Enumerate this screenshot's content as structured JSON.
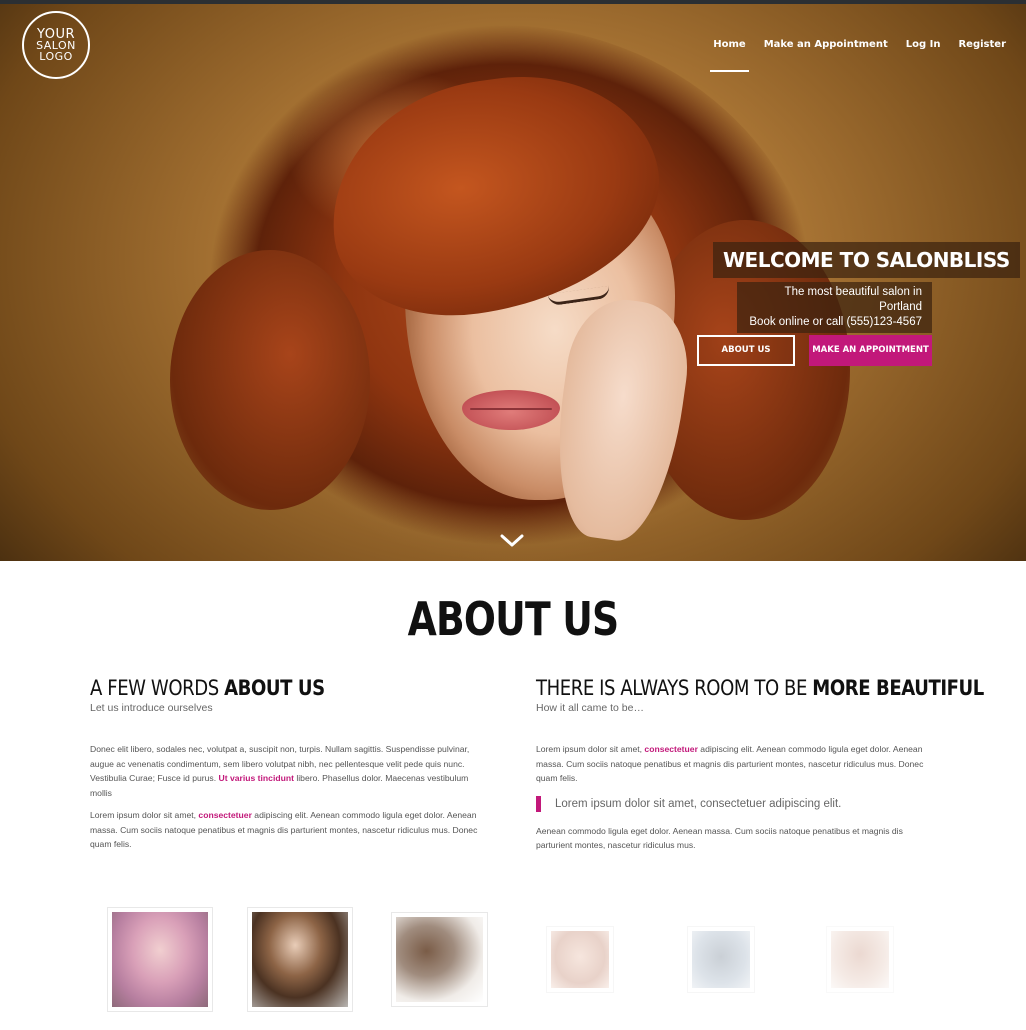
{
  "logo": {
    "line1": "YOUR",
    "line2": "SALON",
    "line3": "LOGO"
  },
  "nav": {
    "items": [
      {
        "label": "Home"
      },
      {
        "label": "Make an Appointment"
      },
      {
        "label": "Log In"
      },
      {
        "label": "Register"
      }
    ],
    "active": "Home"
  },
  "hero": {
    "title": "WELCOME TO SALONBLISS",
    "tagline_line1": "The most beautiful salon in Portland",
    "tagline_line2": "Book online or call (555)123-4567",
    "about_button": "ABOUT US",
    "appointment_button": "MAKE AN APPOINTMENT"
  },
  "about": {
    "title": "ABOUT US",
    "left": {
      "heading_normal": "A FEW WORDS ",
      "heading_bold": "ABOUT US",
      "subtitle": "Let us introduce ourselves",
      "p1_a": "Donec elit libero, sodales nec, volutpat a, suscipit non, turpis. Nullam sagittis. Suspendisse pulvinar, augue ac venenatis condimentum, sem libero volutpat nibh, nec pellentesque velit pede quis nunc. Vestibulia Curae; Fusce id purus. ",
      "p1_link": "Ut varius tincidunt",
      "p1_b": " libero. Phasellus dolor. Maecenas vestibulum mollis",
      "p2_a": "Lorem ipsum dolor sit amet, ",
      "p2_link": "consectetuer",
      "p2_b": " adipiscing elit. Aenean commodo ligula eget dolor. Aenean massa. Cum sociis natoque penatibus et magnis dis parturient montes, nascetur ridiculus mus. Donec quam felis."
    },
    "right": {
      "heading_normal": "THERE IS ALWAYS ROOM TO BE ",
      "heading_bold": "MORE BEAUTIFUL",
      "subtitle": "How it all came to be…",
      "p1_a": "Lorem ipsum dolor sit amet, ",
      "p1_link": "consectetuer",
      "p1_b": " adipiscing elit. Aenean commodo ligula eget dolor. Aenean massa. Cum sociis natoque penatibus et magnis dis parturient montes, nascetur ridiculus mus. Donec quam felis.",
      "quote": "Lorem ipsum dolor sit amet, consectetuer adipiscing elit.",
      "p2": "Aenean commodo ligula eget dolor. Aenean massa. Cum sociis natoque penatibus et magnis dis parturient montes, nascetur ridiculus mus."
    }
  },
  "colors": {
    "accent": "#c2187a",
    "topbar": "#2b2f33"
  },
  "icons": {
    "scroll": "chevron-down-icon"
  }
}
